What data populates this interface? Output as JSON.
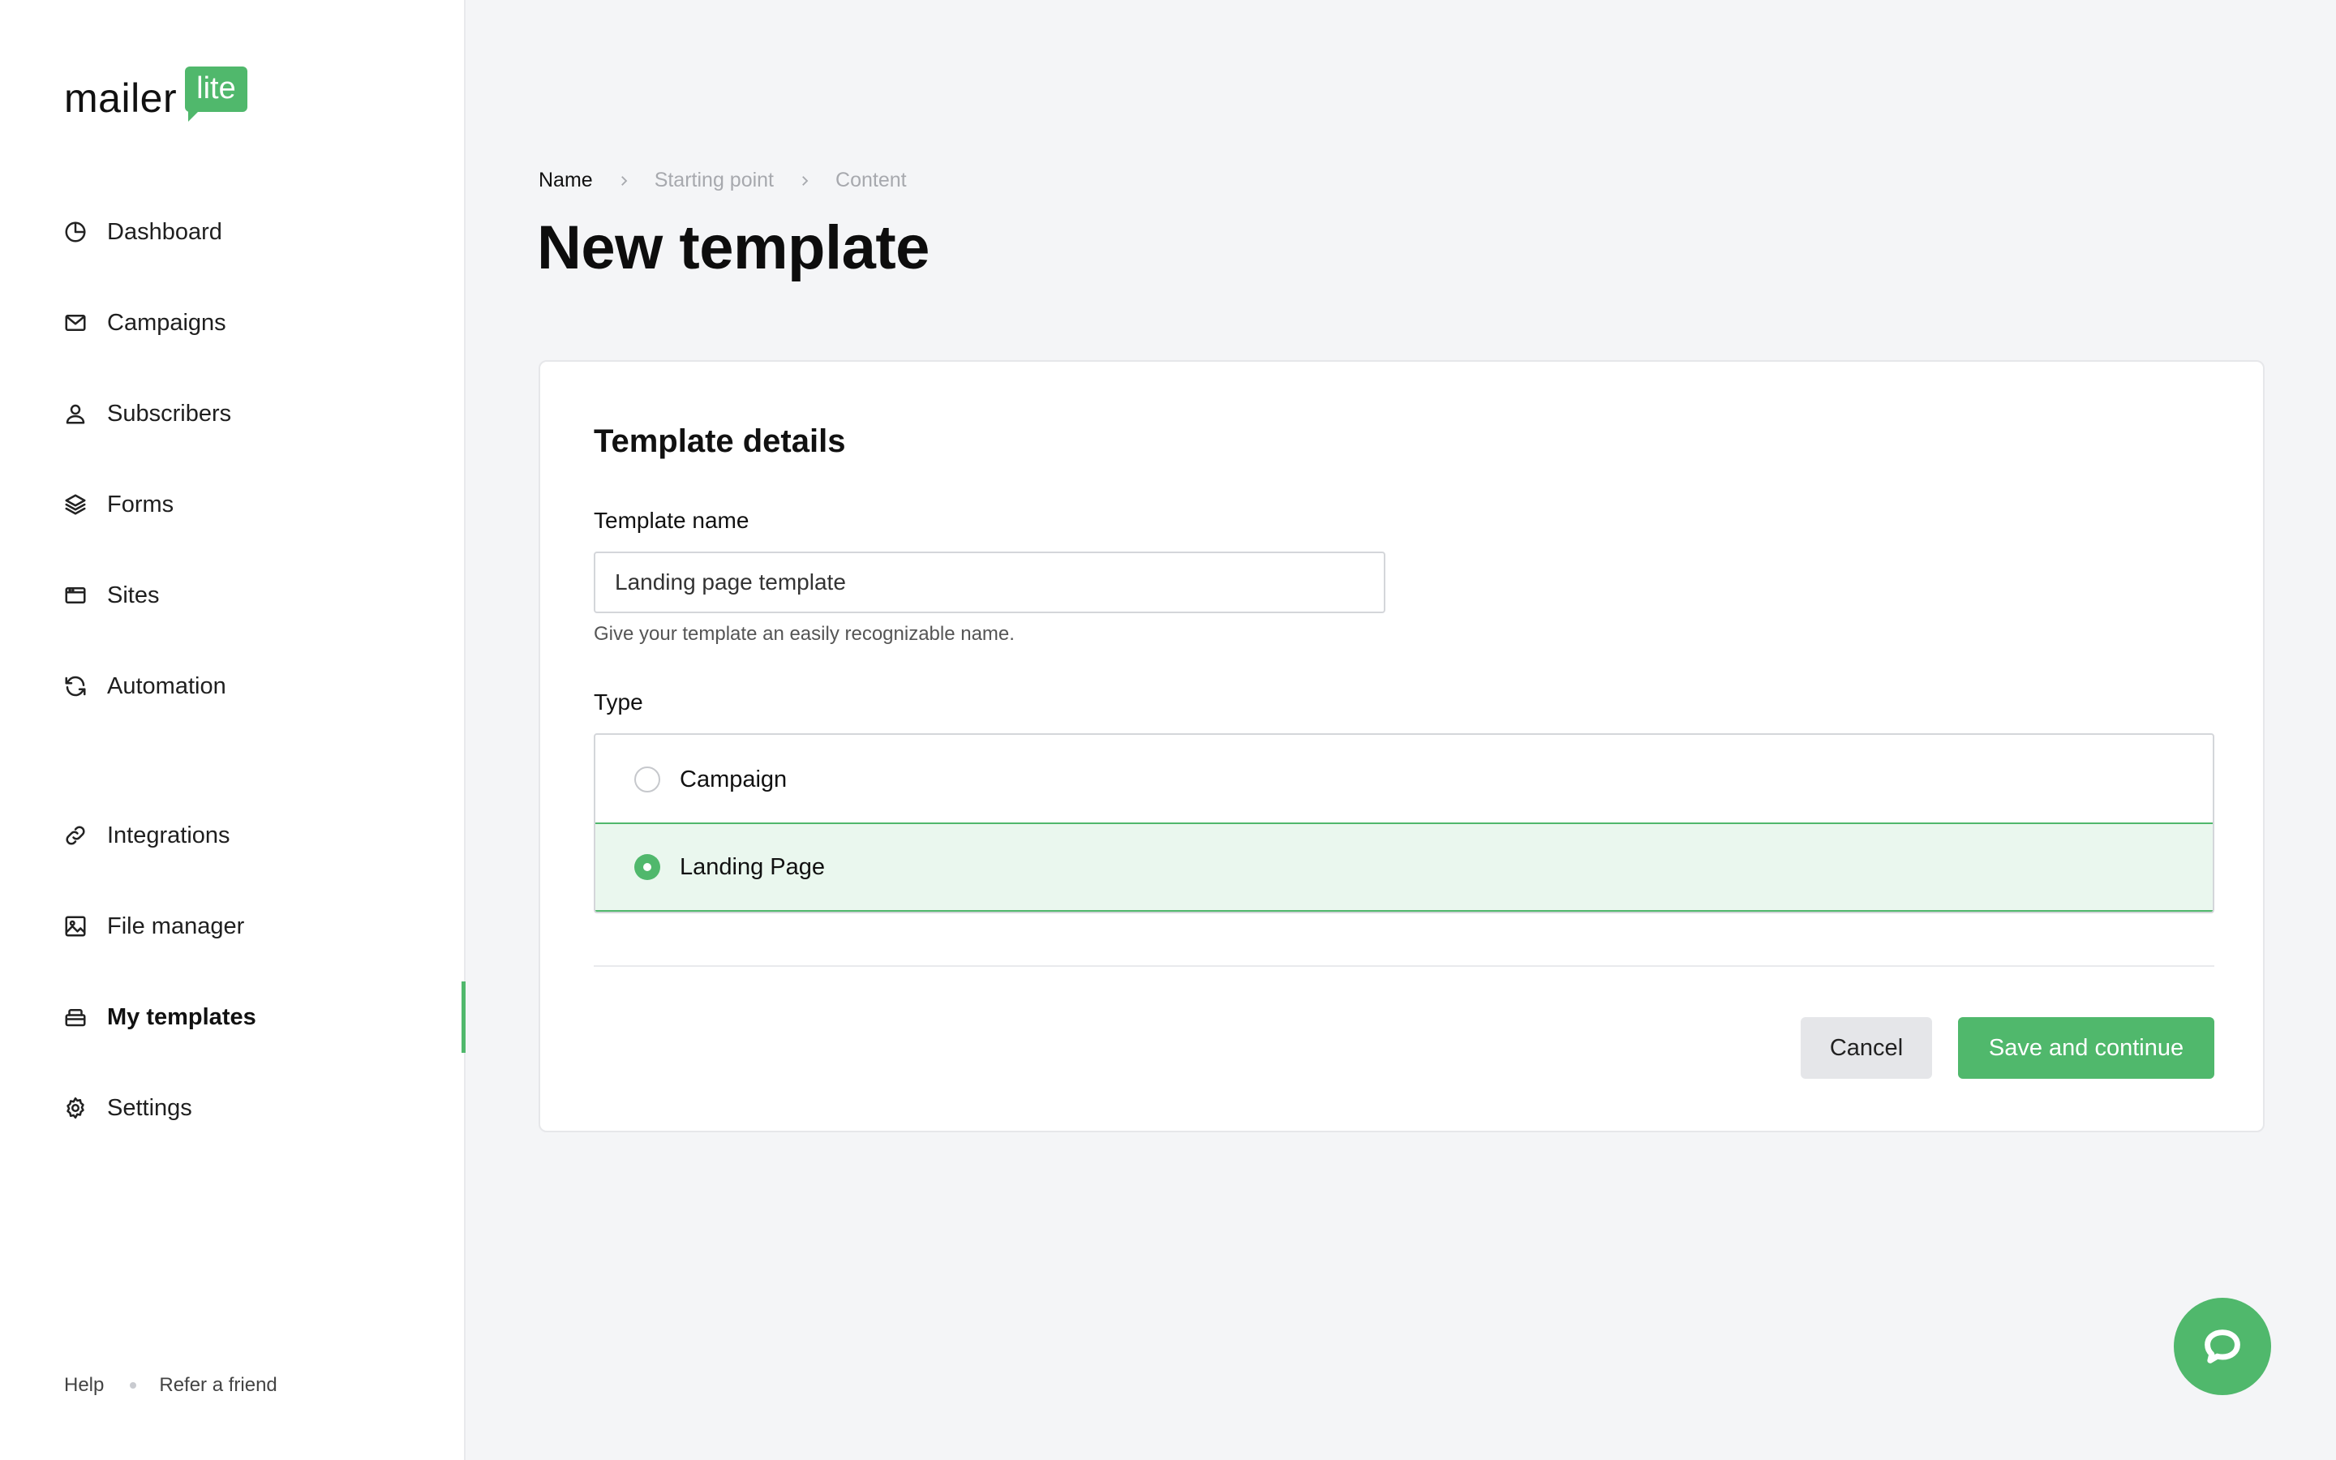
{
  "brand": {
    "word": "mailer",
    "badge": "lite",
    "accent": "#50b86c"
  },
  "sidebar": {
    "items": [
      {
        "label": "Dashboard",
        "icon": "dashboard-icon"
      },
      {
        "label": "Campaigns",
        "icon": "mail-icon"
      },
      {
        "label": "Subscribers",
        "icon": "user-icon"
      },
      {
        "label": "Forms",
        "icon": "layers-icon"
      },
      {
        "label": "Sites",
        "icon": "browser-icon"
      },
      {
        "label": "Automation",
        "icon": "refresh-icon"
      },
      {
        "label": "Integrations",
        "icon": "link-icon"
      },
      {
        "label": "File manager",
        "icon": "image-icon"
      },
      {
        "label": "My templates",
        "icon": "template-icon",
        "active": true
      },
      {
        "label": "Settings",
        "icon": "gear-icon"
      }
    ],
    "footer": {
      "help": "Help",
      "refer": "Refer a friend"
    }
  },
  "breadcrumb": {
    "steps": [
      "Name",
      "Starting point",
      "Content"
    ],
    "current": "Name"
  },
  "page": {
    "title": "New template"
  },
  "card": {
    "title": "Template details",
    "name_label": "Template name",
    "name_value": "Landing page template",
    "name_hint": "Give your template an easily recognizable name.",
    "type_label": "Type",
    "type_options": [
      {
        "label": "Campaign",
        "selected": false
      },
      {
        "label": "Landing Page",
        "selected": true
      }
    ],
    "cancel_label": "Cancel",
    "save_label": "Save and continue"
  },
  "chat": {
    "icon": "chat-bubble-icon"
  }
}
